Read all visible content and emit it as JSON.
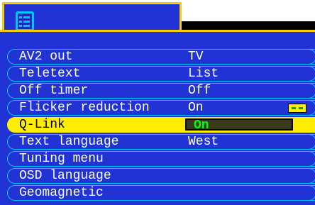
{
  "header": {
    "icon": "menu-list-icon"
  },
  "menu": {
    "items": [
      {
        "label": "AV2 out",
        "value": "TV"
      },
      {
        "label": "Teletext",
        "value": "List"
      },
      {
        "label": "Off timer",
        "value": "Off"
      },
      {
        "label": "Flicker reduction",
        "value": "On"
      },
      {
        "label": "Q-Link",
        "value": "On"
      },
      {
        "label": "Text language",
        "value": "West"
      },
      {
        "label": "Tuning menu",
        "value": ""
      },
      {
        "label": "OSD language",
        "value": ""
      },
      {
        "label": "Geomagnetic",
        "value": ""
      }
    ],
    "selected_index": 4
  },
  "colors": {
    "panel": "#2233d6",
    "border": "#00c8ff",
    "accent": "#ffcc00",
    "selected": "#ffee00",
    "value_text_selected": "#00ff00"
  }
}
